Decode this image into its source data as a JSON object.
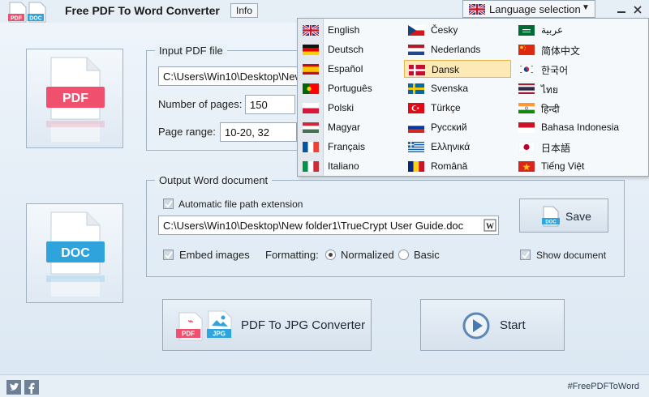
{
  "titlebar": {
    "app_title": "Free PDF To Word Converter",
    "info_label": "Info",
    "language_label": "Language selection",
    "logo_pdf_text": "PDF",
    "logo_doc_text": "DOC"
  },
  "input": {
    "legend": "Input PDF file",
    "path": "C:\\Users\\Win10\\Desktop\\New",
    "pages_label": "Number of pages:",
    "pages_value": "150",
    "range_label": "Page range:",
    "range_value": "10-20, 32",
    "card_text": "PDF"
  },
  "output": {
    "legend": "Output Word document",
    "auto_ext_label": "Automatic file path extension",
    "path": "C:\\Users\\Win10\\Desktop\\New folder1\\TrueCrypt User Guide.doc",
    "save_label": "Save",
    "save_icon_text": "DOC",
    "embed_label": "Embed images",
    "formatting_label": "Formatting:",
    "normalized_label": "Normalized",
    "basic_label": "Basic",
    "show_doc_label": "Show document",
    "card_text": "DOC"
  },
  "actions": {
    "jpg_label": "PDF To JPG Converter",
    "jpg_icon_pdf": "PDF",
    "jpg_icon_jpg": "JPG",
    "start_label": "Start"
  },
  "footer": {
    "hashtag": "#FreePDFToWord"
  },
  "languages": {
    "col1": [
      "English",
      "Deutsch",
      "Español",
      "Português",
      "Polski",
      "Magyar",
      "Français",
      "Italiano"
    ],
    "col2": [
      "Česky",
      "Nederlands",
      "Dansk",
      "Svenska",
      "Türkçe",
      "Русский",
      "Ελληνικά",
      "Română"
    ],
    "col3": [
      "عربية",
      "简体中文",
      "한국어",
      "ไทย",
      "हिन्दी",
      "Bahasa Indonesia",
      "日本語",
      "Tiếng Việt"
    ],
    "selected": "Dansk"
  },
  "colors": {
    "pdf_red": "#f0506e",
    "doc_blue": "#2ea3dc",
    "selection_bg": "#fde9b6"
  }
}
